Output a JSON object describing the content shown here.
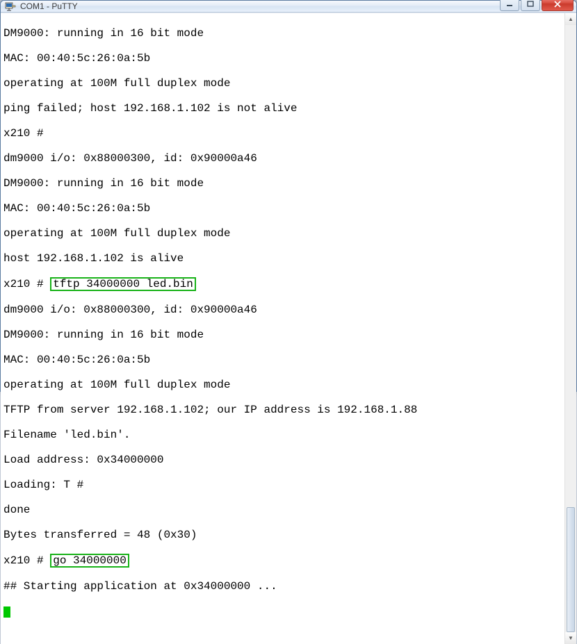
{
  "window": {
    "title": "COM1 - PuTTY"
  },
  "terminal": {
    "lines": [
      "DM9000: running in 16 bit mode",
      "MAC: 00:40:5c:26:0a:5b",
      "operating at 100M full duplex mode",
      "ping failed; host 192.168.1.102 is not alive",
      "x210 #",
      "dm9000 i/o: 0x88000300, id: 0x90000a46",
      "DM9000: running in 16 bit mode",
      "MAC: 00:40:5c:26:0a:5b",
      "operating at 100M full duplex mode",
      "host 192.168.1.102 is alive",
      "tftp 34000000 led.bin",
      "dm9000 i/o: 0x88000300, id: 0x90000a46",
      "DM9000: running in 16 bit mode",
      "MAC: 00:40:5c:26:0a:5b",
      "operating at 100M full duplex mode",
      "TFTP from server 192.168.1.102; our IP address is 192.168.1.88",
      "Filename 'led.bin'.",
      "Load address: 0x34000000",
      "Loading: T #",
      "done",
      "Bytes transferred = 48 (0x30)",
      "go 34000000",
      "## Starting application at 0x34000000 ..."
    ],
    "prompt_prefix": "x210 # "
  },
  "icons": {
    "minimize": "minimize-icon",
    "maximize": "maximize-icon",
    "close": "close-icon",
    "putty": "putty-icon",
    "scroll_up": "▲",
    "scroll_down": "▼"
  }
}
